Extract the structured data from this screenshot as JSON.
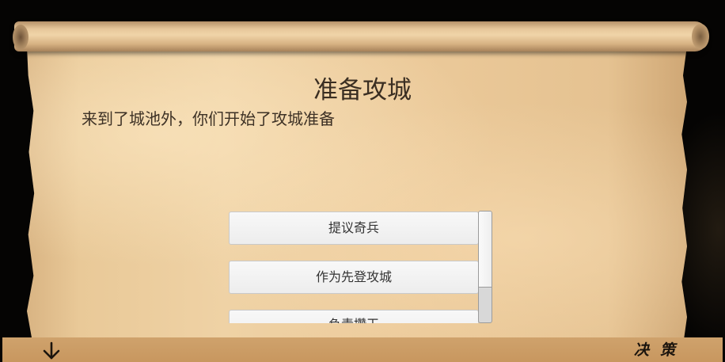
{
  "scene": {
    "title": "准备攻城",
    "description": "来到了城池外，你们开始了攻城准备"
  },
  "options": [
    {
      "label": "提议奇兵"
    },
    {
      "label": "作为先登攻城"
    },
    {
      "label": "负责攒干"
    }
  ],
  "bottom_bar": {
    "left_icon": "arrow-down-icon",
    "label": "决策"
  },
  "colors": {
    "parchment": "#ebc999",
    "bottom_bar": "#cfa26c",
    "title_text": "#3a2e22"
  }
}
